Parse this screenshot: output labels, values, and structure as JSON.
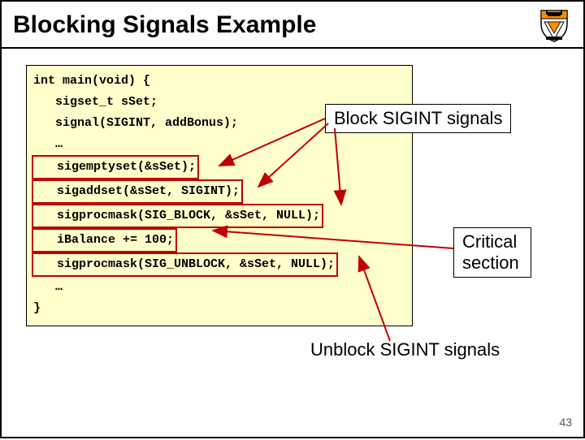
{
  "title": "Blocking Signals Example",
  "code": {
    "l0": "int main(void) {",
    "l1": "   sigset_t sSet;",
    "l2": "   signal(SIGINT, addBonus);",
    "l3": "   …",
    "l4": "   sigemptyset(&sSet);",
    "l5": "   sigaddset(&sSet, SIGINT);",
    "l6": "   sigprocmask(SIG_BLOCK, &sSet, NULL);",
    "l7": "   iBalance += 100;",
    "l8": "   sigprocmask(SIG_UNBLOCK, &sSet, NULL);",
    "l9": "   …",
    "l10": "}"
  },
  "labels": {
    "block": "Block SIGINT signals",
    "critical_1": "Critical",
    "critical_2": "section",
    "unblock": "Unblock SIGINT signals"
  },
  "page_number": "43",
  "icon": {
    "shield_name": "princeton-shield-icon"
  }
}
